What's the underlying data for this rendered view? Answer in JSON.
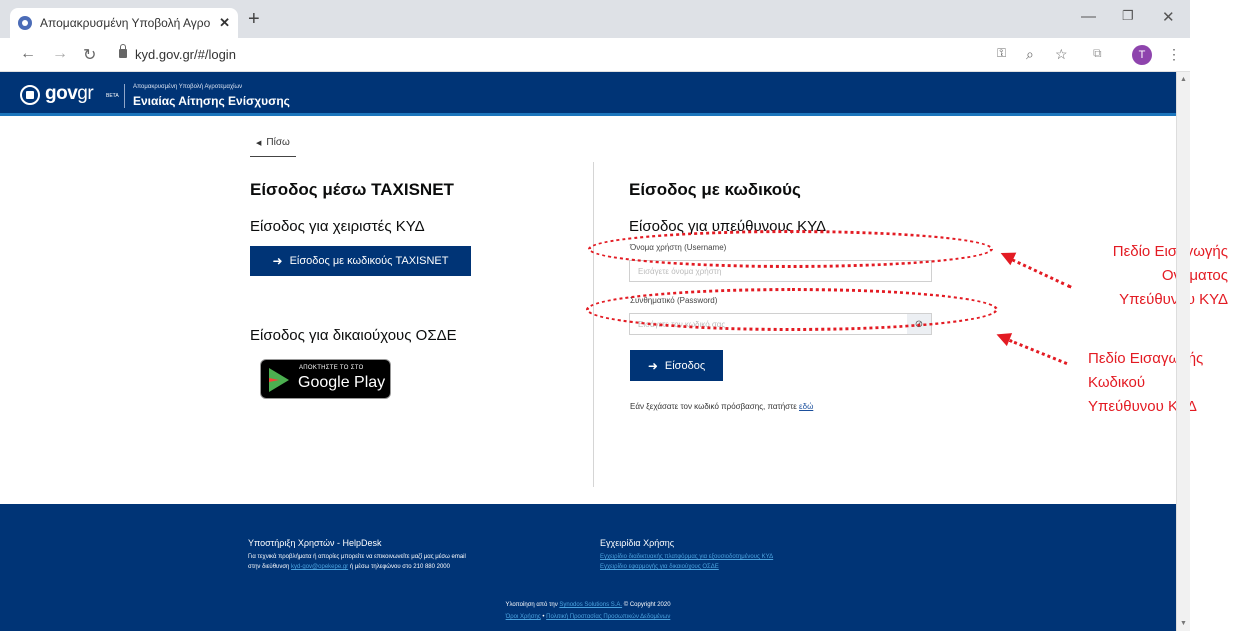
{
  "browser": {
    "tab_title": "Απομακρυσμένη Υποβολή Αγρο",
    "url": "kyd.gov.gr/#/login",
    "avatar_initial": "T"
  },
  "header": {
    "logo_gov": "gov",
    "logo_gr": "gr",
    "logo_beta": "BETA",
    "subtitle": "Απομακρυσμένη Υποβολή Αγροτεμαχίων",
    "title": "Ενιαίας Αίτησης Ενίσχυσης"
  },
  "main": {
    "back_label": "Πίσω",
    "left": {
      "taxisnet_heading": "Είσοδος μέσω TAXISNET",
      "kyd_users_heading": "Είσοδος για χειριστές ΚΥΔ",
      "taxisnet_button": "Είσοδος με κωδικούς TAXISNET",
      "osde_heading": "Είσοδος για δικαιούχους ΟΣΔΕ",
      "gplay_small": "ΑΠΟΚΤΗΣΤΕ ΤΟ ΣΤΟ",
      "gplay_big": "Google Play"
    },
    "right": {
      "codes_heading": "Είσοδος με κωδικούς",
      "responsible_heading": "Είσοδος για υπεύθυνους ΚΥΔ",
      "username_label": "Όνομα χρήστη (Username)",
      "username_placeholder": "Εισάγετε όνομα χρήστη",
      "password_label": "Συνθηματικό (Password)",
      "password_placeholder": "Εισάγετε τον κωδικό σας",
      "login_button": "Είσοδος",
      "forgot_text": "Εάν ξεχάσατε τον κωδικό πρόσβασης, πατήστε",
      "forgot_link": "εδώ"
    }
  },
  "annotations": {
    "username_note": [
      "Πεδίο Εισαγωγής",
      "Ονόματος",
      "Υπεύθυνου ΚΥΔ"
    ],
    "password_note": [
      "Πεδίο Εισαγωγής",
      "Κωδικού",
      "Υπεύθυνου ΚΥΔ"
    ],
    "color": "#e31b23"
  },
  "footer": {
    "helpdesk_title": "Υποστήριξη Χρηστών - HelpDesk",
    "helpdesk_line1": "Για τεχνικά προβλήματα ή απορίες μπορείτε να επικοινωνείτε μαζί μας μέσω email",
    "helpdesk_line2_pre": "στην διεύθυνση",
    "helpdesk_email": "kyd-gov@opekepe.gr",
    "helpdesk_line2_post": "ή μέσω τηλεφώνου στο 210 880 2000",
    "manuals_title": "Εγχειρίδια Χρήσης",
    "manual_1": "Εγχειρίδιο διαδικτυακής πλατφόρμας για εξουσιοδοτημένους ΚΥΔ",
    "manual_2": "Εγχειρίδιο εφαρμογής για δικαιούχους ΟΣΔΕ",
    "impl_pre": "Υλοποίηση από την",
    "impl_company": "Synodos Solutions S.A.",
    "impl_post": "© Copyright 2020",
    "terms": "Όροι Χρήσης",
    "privacy": "Πολιτική Προστασίας Προσωπικών Δεδομένων"
  },
  "colors": {
    "primary": "#003476",
    "accent": "#1b75bc",
    "annotation": "#e31b23"
  }
}
